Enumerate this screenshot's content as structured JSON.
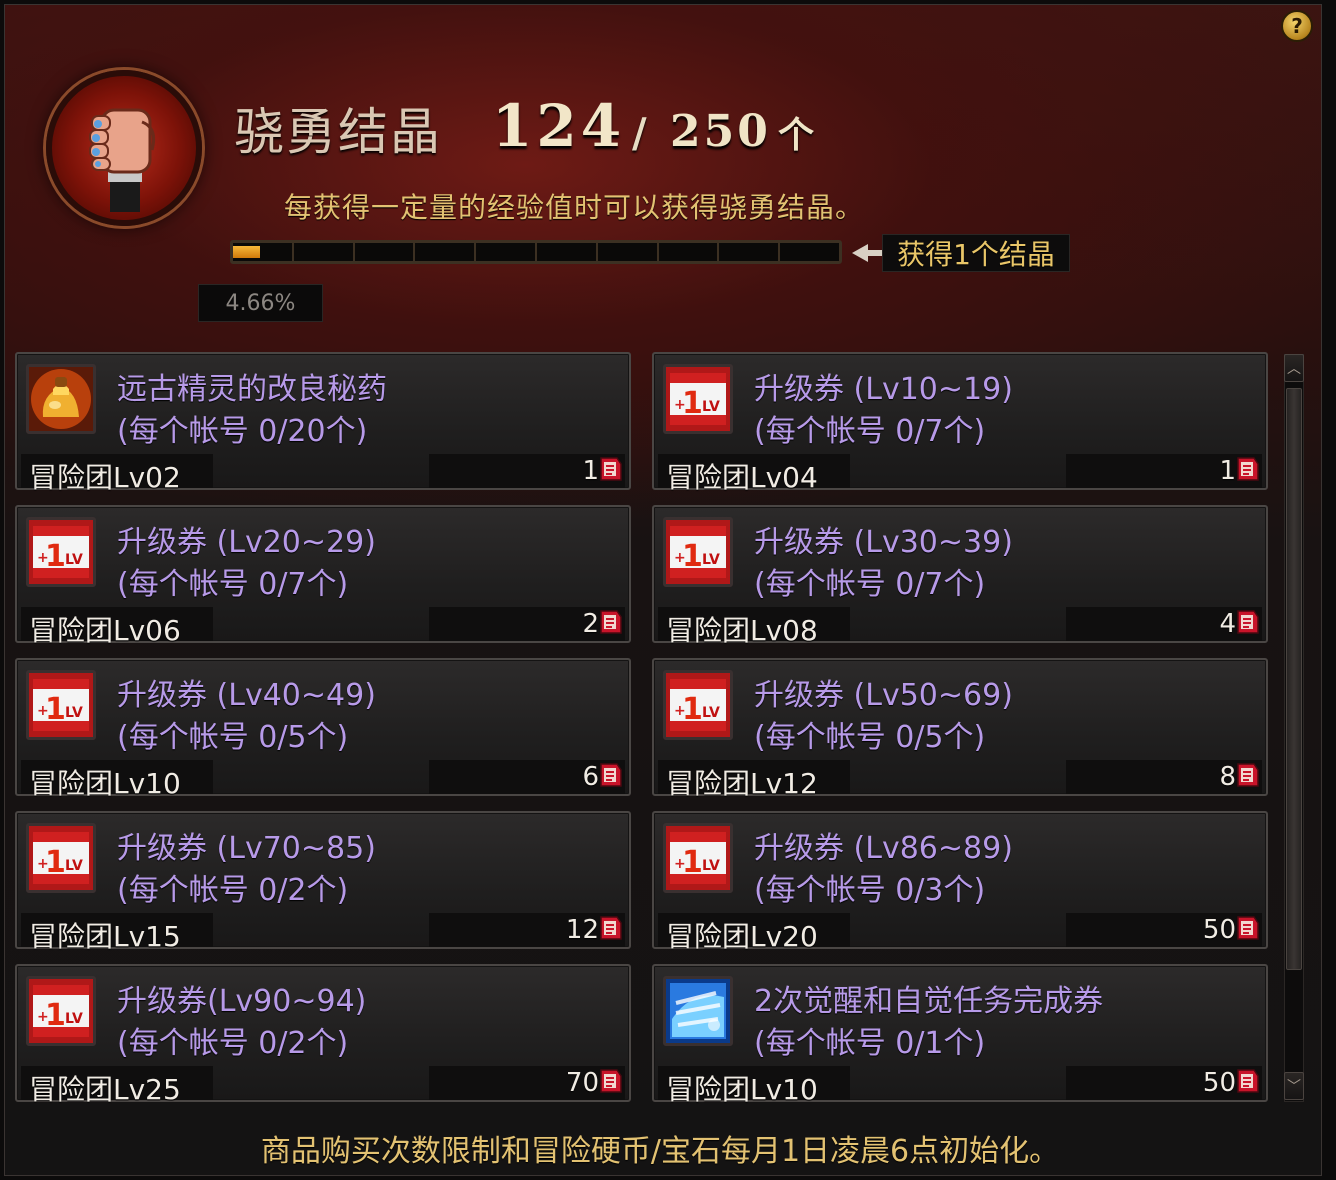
{
  "header": {
    "help_label": "?",
    "title": "骁勇结晶",
    "count_current": "124",
    "count_separator": "/",
    "count_max": "250",
    "count_unit": "个",
    "description": "每获得一定量的经验值时可以获得骁勇结晶。",
    "progress_percent_text": "4.66%",
    "progress_fraction": 0.0466,
    "reward_text": "获得1个结晶"
  },
  "items": [
    {
      "name": "远古精灵的改良秘药",
      "limit": "(每个帐号 0/20个)",
      "requirement": "冒险团Lv02",
      "price": "1",
      "icon": "elixir-icon"
    },
    {
      "name": "升级券 (Lv10~19)",
      "limit": "(每个帐号 0/7个)",
      "requirement": "冒险团Lv04",
      "price": "1",
      "icon": "level-up-ticket-icon"
    },
    {
      "name": "升级券 (Lv20~29)",
      "limit": "(每个帐号 0/7个)",
      "requirement": "冒险团Lv06",
      "price": "2",
      "icon": "level-up-ticket-icon"
    },
    {
      "name": "升级券 (Lv30~39)",
      "limit": "(每个帐号 0/7个)",
      "requirement": "冒险团Lv08",
      "price": "4",
      "icon": "level-up-ticket-icon"
    },
    {
      "name": "升级券 (Lv40~49)",
      "limit": "(每个帐号 0/5个)",
      "requirement": "冒险团Lv10",
      "price": "6",
      "icon": "level-up-ticket-icon"
    },
    {
      "name": "升级券 (Lv50~69)",
      "limit": "(每个帐号 0/5个)",
      "requirement": "冒险团Lv12",
      "price": "8",
      "icon": "level-up-ticket-icon"
    },
    {
      "name": "升级券 (Lv70~85)",
      "limit": "(每个帐号 0/2个)",
      "requirement": "冒险团Lv15",
      "price": "12",
      "icon": "level-up-ticket-icon"
    },
    {
      "name": "升级券 (Lv86~89)",
      "limit": "(每个帐号 0/3个)",
      "requirement": "冒险团Lv20",
      "price": "50",
      "icon": "level-up-ticket-icon"
    },
    {
      "name": "升级券(Lv90~94)",
      "limit": "(每个帐号 0/2个)",
      "requirement": "冒险团Lv25",
      "price": "70",
      "icon": "level-up-ticket-icon"
    },
    {
      "name": "2次觉醒和自觉任务完成券",
      "limit": "(每个帐号 0/1个)",
      "requirement": "冒险团Lv10",
      "price": "50",
      "icon": "awakening-quest-ticket-icon"
    }
  ],
  "footer": {
    "notice": "商品购买次数限制和冒险硬币/宝石每月1日凌晨6点初始化。"
  },
  "scrollbar": {
    "up_label": "︿",
    "down_label": "﹀"
  },
  "colors": {
    "item_text": "#b79ae8",
    "gold_text": "#e3c272",
    "progress_fill": "#f0a020"
  }
}
